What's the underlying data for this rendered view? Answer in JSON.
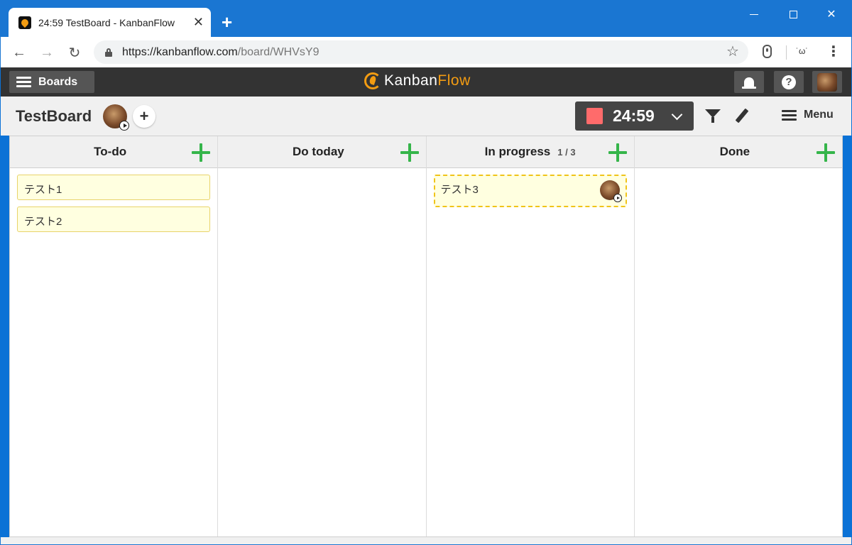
{
  "browser": {
    "tab_title": "24:59 TestBoard - KanbanFlow",
    "url_host": "https://kanbanflow.com",
    "url_path": "/board/WHVsY9",
    "extension_face": "˙ω˙"
  },
  "app": {
    "boards_label": "Boards",
    "logo_kanban": "Kanban",
    "logo_flow": "Flow",
    "help_glyph": "?"
  },
  "board": {
    "title": "TestBoard",
    "add_member_glyph": "+",
    "timer": "24:59",
    "timer_color": "#ff6b6b",
    "menu_label": "Menu"
  },
  "columns": [
    {
      "name": "To-do",
      "wip": "",
      "tasks": [
        "テスト1",
        "テスト2"
      ]
    },
    {
      "name": "Do today",
      "wip": "",
      "tasks": []
    },
    {
      "name": "In progress",
      "wip": "1 / 3",
      "tasks": [
        "テスト3"
      ]
    },
    {
      "name": "Done",
      "wip": "",
      "tasks": []
    }
  ],
  "colors": {
    "appbar": "#333333",
    "accent_green": "#35b54a",
    "logo_orange": "#f39c12",
    "task_bg": "#ffffe0",
    "browser_blue": "#1a76d2"
  }
}
